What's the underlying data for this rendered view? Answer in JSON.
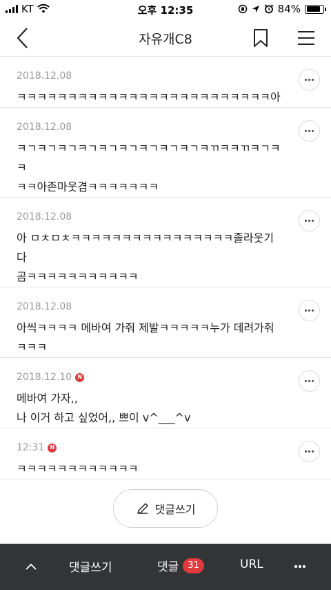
{
  "status_bar": {
    "carrier": "KT",
    "time": "오후 12:35",
    "battery": "84%",
    "battery_level": 0.84
  },
  "nav": {
    "title": "자유개C8"
  },
  "comments": [
    {
      "date": "2018.12.08",
      "is_new": false,
      "text": "ㅋㅋㅋㅋㅋㅋㅋㅋㅋㅋㅋㅋㅋㅋㅋㅋㅋㅋㅋㅋㅋㅋㅋㅋㅋ아"
    },
    {
      "date": "2018.12.08",
      "is_new": false,
      "text": "ㅋㄱㅋㄱㅋㄱㅋㄱㅋㄱㅋㄱㅋㄱㅋㄱㅋㄱㅋㄲㅋㅋㄲㅋㄱㅋㅋ\nㅋㅋ아존마웃겸ㅋㅋㅋㅋㅋㅋㅋ"
    },
    {
      "date": "2018.12.08",
      "is_new": false,
      "text": "아 ㅁㅊㅁㅊㅋㅋㅋㅋㅋㅋㅋㅋㅋㅋㅋㅋㅋㅋㅋㅋ졸라웃기다\n곰ㅋㅋㅋㅋㅋㅋㅋㅋㅋㅋㅋ"
    },
    {
      "date": "2018.12.08",
      "is_new": false,
      "text": "아씩ㅋㅋㅋㅋ 메바여 가줘 제발ㅋㅋㅋㅋㅋ누가 데려가줘\nㅋㅋㅋ"
    },
    {
      "date": "2018.12.10",
      "is_new": true,
      "text": "메바여 가자,,\n나 이거 하고 싶었어,, 쁘이 v^___^v"
    },
    {
      "date": "12:31",
      "is_new": true,
      "text": "ㅋㅋㅋㅋㅋㅋㅋㅋㅋㅋㅋㅋ"
    }
  ],
  "new_badge_label": "N",
  "write_button": {
    "label": "댓글쓰기"
  },
  "bottom_bar": {
    "write_label": "댓글쓰기",
    "comments_label": "댓글",
    "comments_count": "31",
    "url_label": "URL"
  },
  "icons": {
    "back": "chevron-left-icon",
    "bookmark": "bookmark-icon",
    "menu": "hamburger-menu-icon",
    "more": "more-dots-icon",
    "pencil": "pencil-icon",
    "up": "chevron-up-icon"
  },
  "colors": {
    "badge_red": "#e0393e",
    "bottom_bar": "#333436",
    "date_gray": "#9a9a9a"
  }
}
